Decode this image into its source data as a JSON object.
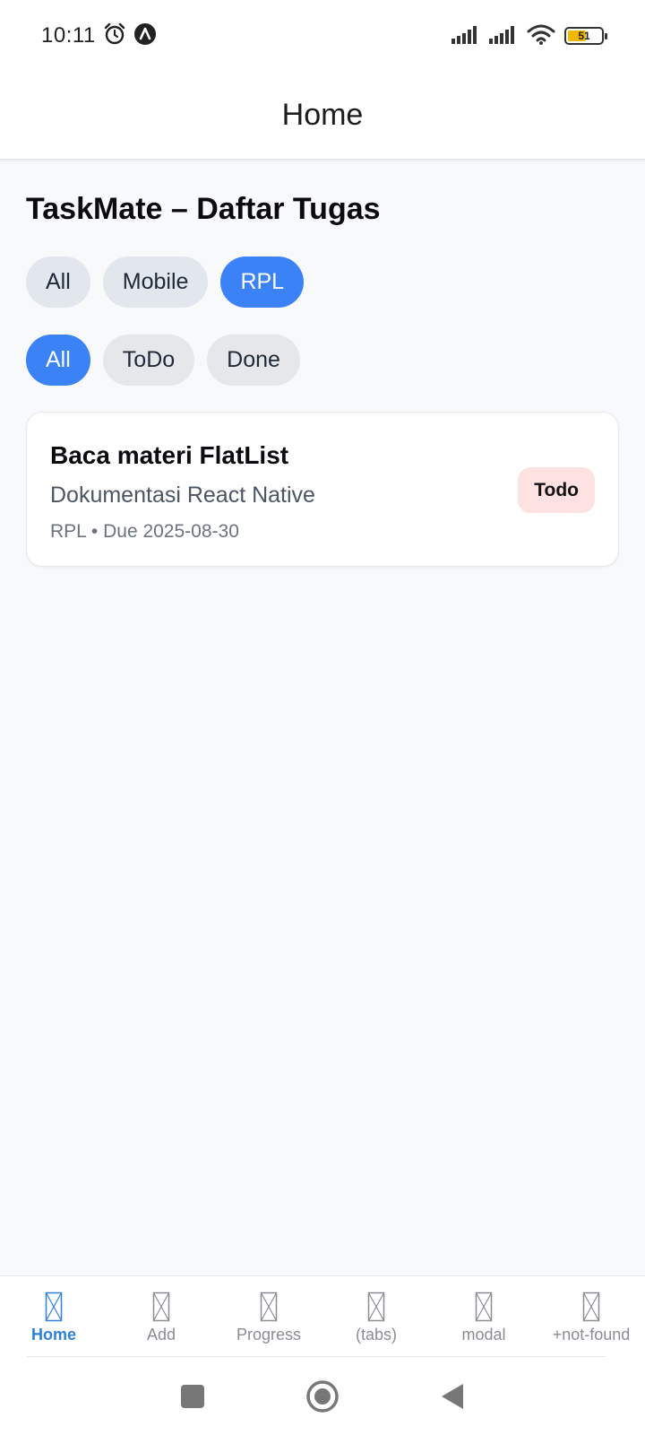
{
  "status_bar": {
    "time": "10:11",
    "battery_level": "51",
    "icons": [
      "alarm-icon",
      "a-badge-icon",
      "signal-icon",
      "signal-icon",
      "wifi-icon",
      "battery-icon"
    ]
  },
  "header": {
    "title": "Home"
  },
  "main": {
    "title": "TaskMate – Daftar Tugas",
    "category_filters": [
      {
        "label": "All",
        "active": false
      },
      {
        "label": "Mobile",
        "active": false
      },
      {
        "label": "RPL",
        "active": true
      }
    ],
    "status_filters": [
      {
        "label": "All",
        "active": true
      },
      {
        "label": "ToDo",
        "active": false
      },
      {
        "label": "Done",
        "active": false
      }
    ],
    "tasks": [
      {
        "title": "Baca materi FlatList",
        "subtitle": "Dokumentasi React Native",
        "meta": "RPL • Due 2025-08-30",
        "status": "Todo"
      }
    ]
  },
  "tabs": [
    {
      "label": "Home",
      "active": true
    },
    {
      "label": "Add",
      "active": false
    },
    {
      "label": "Progress",
      "active": false
    },
    {
      "label": "(tabs)",
      "active": false
    },
    {
      "label": "modal",
      "active": false
    },
    {
      "label": "+not-found",
      "active": false
    }
  ],
  "colors": {
    "accent": "#3b82f6",
    "tab_active": "#2f80d9",
    "badge_todo_bg": "#fee2e2",
    "battery": "#f2b705"
  },
  "nav_bar": {
    "icons": [
      "recents-square-icon",
      "home-circle-icon",
      "back-triangle-icon"
    ]
  }
}
